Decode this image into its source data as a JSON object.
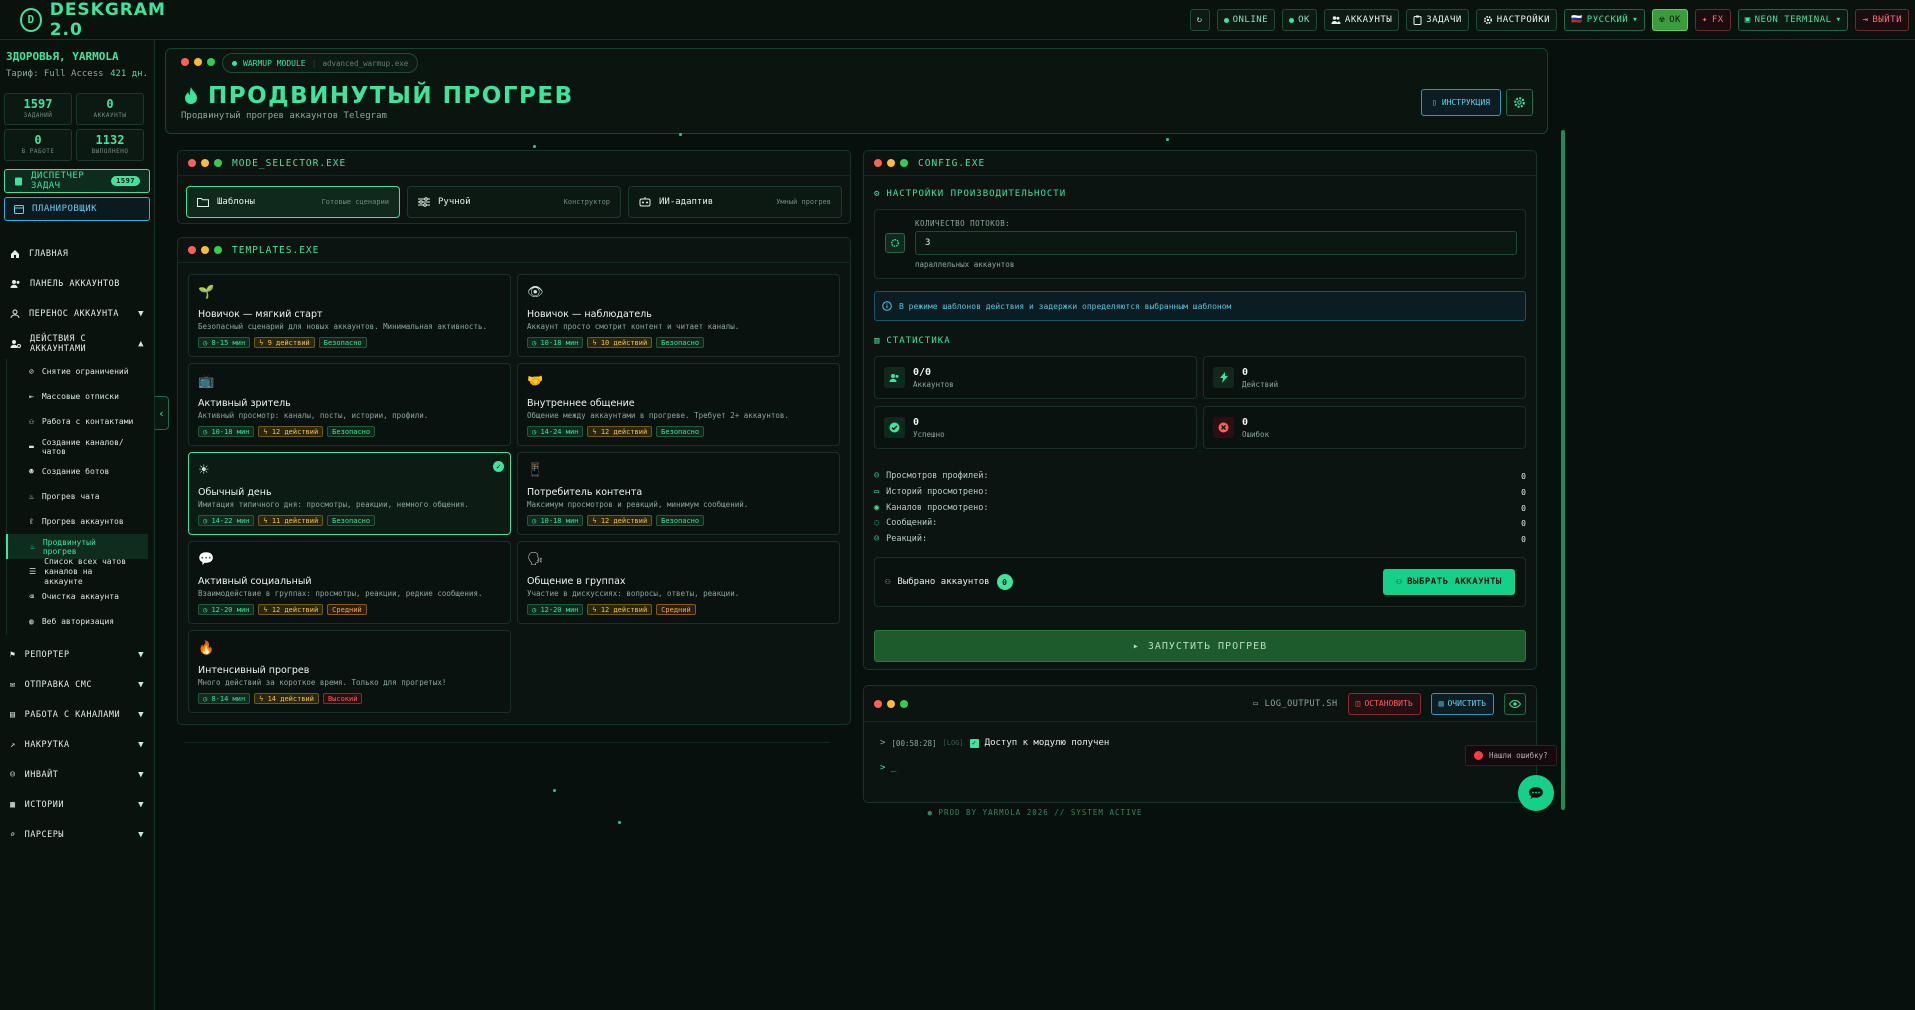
{
  "app": {
    "logo_mark": "D",
    "title": "DESKGRAM 2.0"
  },
  "topbar": {
    "refresh": "↻",
    "online": "ONLINE",
    "ok": "OK",
    "accounts": "АККАУНТЫ",
    "tasks": "ЗАДАЧИ",
    "settings": "НАСТРОЙКИ",
    "language": "РУССКИЙ",
    "language_flag": "🇷🇺",
    "status_ok": "OK",
    "fx": "FX",
    "theme": "NEON TERMINAL",
    "logout": "ВЫЙТИ"
  },
  "user": {
    "greeting": "ЗДОРОВЬЯ, YARMOLA",
    "plan_label": "Тариф: Full Access",
    "days": "421 дн."
  },
  "stats": [
    {
      "value": "1597",
      "label": "ЗАДАНИЙ"
    },
    {
      "value": "0",
      "label": "АККАУНТЫ"
    },
    {
      "value": "0",
      "label": "В РАБОТЕ"
    },
    {
      "value": "1132",
      "label": "ВЫПОЛНЕНО"
    }
  ],
  "dispatcher": {
    "label": "ДИСПЕТЧЕР ЗАДАЧ",
    "badge": "1597"
  },
  "scheduler": {
    "label": "ПЛАНИРОВЩИК"
  },
  "nav": [
    {
      "label": "ГЛАВНАЯ",
      "icon": "home-icon"
    },
    {
      "label": "ПАНЕЛЬ АККАУНТОВ",
      "icon": "users-icon"
    },
    {
      "label": "ПЕРЕНОС АККАУНТА",
      "icon": "transfer-icon"
    },
    {
      "label": "ДЕЙСТВИЯ С АККАУНТАМИ",
      "icon": "user-gear-icon"
    }
  ],
  "subnav": [
    {
      "label": "Снятие ограничений",
      "icon": "unlock-icon"
    },
    {
      "label": "Массовые отписки",
      "icon": "logout-icon"
    },
    {
      "label": "Работа с контактами",
      "icon": "contacts-icon"
    },
    {
      "label": "Создание каналов/чатов",
      "icon": "chat-icon"
    },
    {
      "label": "Создание ботов",
      "icon": "bot-icon"
    },
    {
      "label": "Прогрев чата",
      "icon": "flame-icon"
    },
    {
      "label": "Прогрев аккаунтов",
      "icon": "thermometer-icon"
    },
    {
      "label": "Продвинутый прогрев",
      "icon": "flame-icon"
    },
    {
      "label1": "Список всех чатов",
      "label2": "каналов на аккаунте",
      "icon": "list-icon"
    },
    {
      "label": "Очистка аккаунта",
      "icon": "trash-icon"
    },
    {
      "label": "Веб авторизация",
      "icon": "globe-icon"
    }
  ],
  "nav2": [
    {
      "label": "РЕПОРТЕР",
      "icon": "flag-icon"
    },
    {
      "label": "ОТПРАВКА СМС",
      "icon": "message-icon"
    },
    {
      "label": "РАБОТА С КАНАЛАМИ",
      "icon": "briefcase-icon"
    },
    {
      "label": "НАКРУТКА",
      "icon": "chart-icon"
    },
    {
      "label": "ИНВАЙТ",
      "icon": "user-plus-icon"
    },
    {
      "label": "ИСТОРИИ",
      "icon": "stories-icon"
    },
    {
      "label": "ПАРСЕРЫ",
      "icon": "search-icon"
    }
  ],
  "header": {
    "module_tag": "WARMUP MODULE",
    "module_file": "advanced_warmup.exe",
    "title": "ПРОДВИНУТЫЙ ПРОГРЕВ",
    "subtitle": "Продвинутый прогрев аккаунтов Telegram",
    "instructions": "ИНСТРУКЦИЯ"
  },
  "mode_panel": {
    "title": "MODE_SELECTOR.EXE",
    "modes": [
      {
        "label": "Шаблоны",
        "desc": "Готовые сценарии",
        "icon": "folder-icon"
      },
      {
        "label": "Ручной",
        "desc": "Конструктор",
        "icon": "sliders-icon"
      },
      {
        "label": "ИИ-адаптив",
        "desc": "Умный прогрев",
        "icon": "robot-icon"
      }
    ]
  },
  "templates_panel": {
    "title": "TEMPLATES.EXE",
    "cards": [
      {
        "emoji": "🌱",
        "name": "Новичок — мягкий старт",
        "desc": "Безопасный сценарий для новых аккаунтов. Минимальная активность.",
        "time": "8-15 мин",
        "actions": "9 действий",
        "risk": "Безопасно",
        "risk_type": "safe"
      },
      {
        "emoji": "👁",
        "name": "Новичок — наблюдатель",
        "desc": "Аккаунт просто смотрит контент и читает каналы.",
        "time": "10-18 мин",
        "actions": "10 действий",
        "risk": "Безопасно",
        "risk_type": "safe"
      },
      {
        "emoji": "📺",
        "name": "Активный зритель",
        "desc": "Активный просмотр: каналы, посты, истории, профили.",
        "time": "10-18 мин",
        "actions": "12 действий",
        "risk": "Безопасно",
        "risk_type": "safe"
      },
      {
        "emoji": "🤝",
        "name": "Внутреннее общение",
        "desc": "Общение между аккаунтами в прогреве. Требует 2+ аккаунтов.",
        "time": "14-24 мин",
        "actions": "12 действий",
        "risk": "Безопасно",
        "risk_type": "safe"
      },
      {
        "emoji": "☀",
        "name": "Обычный день",
        "desc": "Имитация типичного дня: просмотры, реакции, немного общения.",
        "time": "14-22 мин",
        "actions": "11 действий",
        "risk": "Безопасно",
        "risk_type": "safe"
      },
      {
        "emoji": "📱",
        "name": "Потребитель контента",
        "desc": "Максимум просмотров и реакций, минимум сообщений.",
        "time": "10-18 мин",
        "actions": "12 действий",
        "risk": "Безопасно",
        "risk_type": "safe"
      },
      {
        "emoji": "💬",
        "name": "Активный социальный",
        "desc": "Взаимодействие в группах: просмотры, реакции, редкие сообщения.",
        "time": "12-20 мин",
        "actions": "12 действий",
        "risk": "Средний",
        "risk_type": "mid"
      },
      {
        "emoji": "🗣",
        "name": "Общение в группах",
        "desc": "Участие в дискуссиях: вопросы, ответы, реакции.",
        "time": "12-20 мин",
        "actions": "12 действий",
        "risk": "Средний",
        "risk_type": "mid"
      },
      {
        "emoji": "🔥",
        "name": "Интенсивный прогрев",
        "desc": "Много действий за короткое время. Только для прогретых!",
        "time": "8-14 мин",
        "actions": "14 действий",
        "risk": "Высокий",
        "risk_type": "high"
      }
    ],
    "selected_index": 4
  },
  "config": {
    "title": "CONFIG.EXE",
    "perf_title": "НАСТРОЙКИ ПРОИЗВОДИТЕЛЬНОСТИ",
    "threads_label": "КОЛИЧЕСТВО ПОТОКОВ:",
    "threads_value": "3",
    "threads_hint": "параллельных аккаунтов",
    "info": "В режиме шаблонов действия и задержки определяются выбранным шаблоном",
    "stats_title": "СТАТИСТИКА",
    "stat_cards": [
      {
        "value": "0/0",
        "label": "Аккаунтов",
        "icon": "users-icon",
        "color": "#3be59b"
      },
      {
        "value": "0",
        "label": "Действий",
        "icon": "bolt-icon",
        "color": "#3be59b"
      },
      {
        "value": "0",
        "label": "Успешно",
        "icon": "check-icon",
        "color": "#3be59b"
      },
      {
        "value": "0",
        "label": "Ошибок",
        "icon": "x-icon",
        "color": "#ff5c5c"
      }
    ],
    "metrics": [
      {
        "label": "Просмотров профилей:",
        "value": "0",
        "icon": "user-icon"
      },
      {
        "label": "Историй просмотрено:",
        "value": "0",
        "icon": "image-icon"
      },
      {
        "label": "Каналов просмотрено:",
        "value": "0",
        "icon": "broadcast-icon"
      },
      {
        "label": "Сообщений:",
        "value": "0",
        "icon": "message-icon"
      },
      {
        "label": "Реакций:",
        "value": "0",
        "icon": "smile-icon"
      }
    ],
    "selected_label": "Выбрано аккаунтов",
    "selected_count": "0",
    "select_btn": "ВЫБРАТЬ АККАУНТЫ",
    "start_btn": "ЗАПУСТИТЬ ПРОГРЕВ"
  },
  "log": {
    "file": "LOG_OUTPUT.SH",
    "stop": "ОСТАНОВИТЬ",
    "clear": "ОЧИСТИТЬ",
    "line_time": "[00:58:28]",
    "line_level": "[LOG]",
    "line_text": "Доступ к модулю получен",
    "prompt": "> _",
    "prompt_prefix": ">"
  },
  "error_report": "Нашли ошибку?",
  "footer": "● PROD BY YARMOLA 2026  // SYSTEM ACTIVE",
  "colors": {
    "accent": "#3be59b",
    "danger": "#ff5c5c",
    "info": "#5fd2ee"
  }
}
